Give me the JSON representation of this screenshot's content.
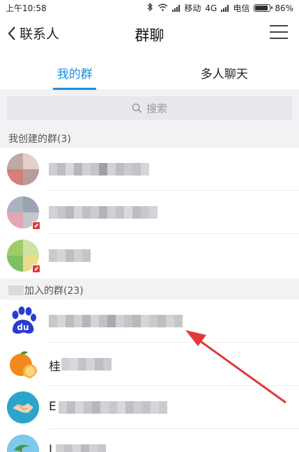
{
  "status_bar": {
    "time": "上午10:58",
    "carrier1": "移动",
    "network": "4G",
    "carrier2": "电信",
    "battery": "86%",
    "battery_level": 0.86
  },
  "nav": {
    "back_label": "联系人",
    "title": "群聊"
  },
  "tabs": [
    {
      "label": "我的群",
      "active": true
    },
    {
      "label": "多人聊天",
      "active": false
    }
  ],
  "search": {
    "placeholder": "搜索"
  },
  "sections": {
    "created": "我创建的群(3)",
    "joined": "加入的群(23)"
  },
  "rows_visible_text": {
    "orange_prefix": "桂",
    "handshake_prefix": "E",
    "last_prefix": "I"
  },
  "colors": {
    "accent": "#1a8fe0",
    "background_section": "#f2f2f4",
    "arrow": "#e03a3a",
    "no_disturb_badge": "#e23a2f"
  },
  "icons": [
    "back-chevron-icon",
    "menu-icon",
    "search-icon",
    "bluetooth-icon",
    "wifi-icon",
    "signal-icon",
    "battery-icon",
    "no-disturb-icon",
    "annotation-arrow-icon"
  ]
}
